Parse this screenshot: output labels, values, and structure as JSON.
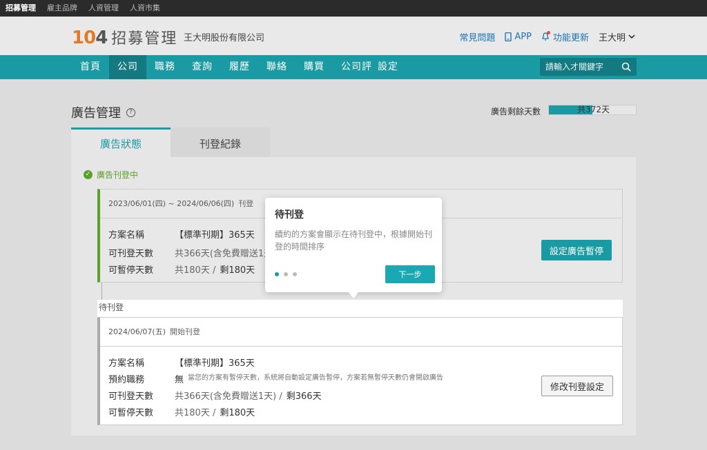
{
  "topbar": {
    "items": [
      "招募管理",
      "雇主品牌",
      "人資管理",
      "人資市集"
    ]
  },
  "header": {
    "logo_num_a": "1",
    "logo_num_b": "0",
    "logo_num_c": "4",
    "logo_title": "招募管理",
    "company": "王大明股份有限公司",
    "faq": "常見問題",
    "app": "APP",
    "updates": "功能更新",
    "user": "王大明"
  },
  "nav": {
    "items": [
      "首頁",
      "公司",
      "職務",
      "查詢",
      "履歷",
      "聯絡",
      "購買",
      "公司評",
      "設定"
    ],
    "search_placeholder": "請輸入才關鍵字"
  },
  "page": {
    "title": "廣告管理",
    "remain_label": "廣告剩餘天數",
    "remain_value": "共372天",
    "remain_fraction": 0.5
  },
  "tabs": [
    "廣告狀態",
    "刊登紀錄"
  ],
  "active": {
    "status": "廣告刊登中",
    "date_range": "2023/06/01(四) ~ 2024/06/06(四)",
    "date_note": "刊登",
    "plan_label": "方案名稱",
    "plan_value": "【標準刊期】365天",
    "days_label": "可刊登天數",
    "days_value": "共366天(含免費贈送1天",
    "pause_label": "可暫停天數",
    "pause_total": "共180天 /",
    "pause_remain": "剩180天",
    "button": "設定廣告暫停"
  },
  "pending": {
    "label": "待刊登",
    "date": "2024/06/07(五)",
    "date_note": "開始刊登",
    "plan_label": "方案名稱",
    "plan_value": "【標準刊期】365天",
    "job_label": "預約職務",
    "job_value": "無",
    "job_note": "當您的方案有暫停天數，系統將自動設定廣告暫停，方案若無暫停天數仍會開啟廣告",
    "days_label": "可刊登天數",
    "days_total": "共366天(含免費贈送1天) /",
    "days_remain": "剩366天",
    "pause_label": "可暫停天數",
    "pause_total": "共180天 /",
    "pause_remain": "剩180天",
    "button": "修改刊登設定"
  },
  "tooltip": {
    "title": "待刊登",
    "body": "續約的方案會顯示在待刊登中，根據開始刊登的時間排序",
    "next": "下一步"
  }
}
